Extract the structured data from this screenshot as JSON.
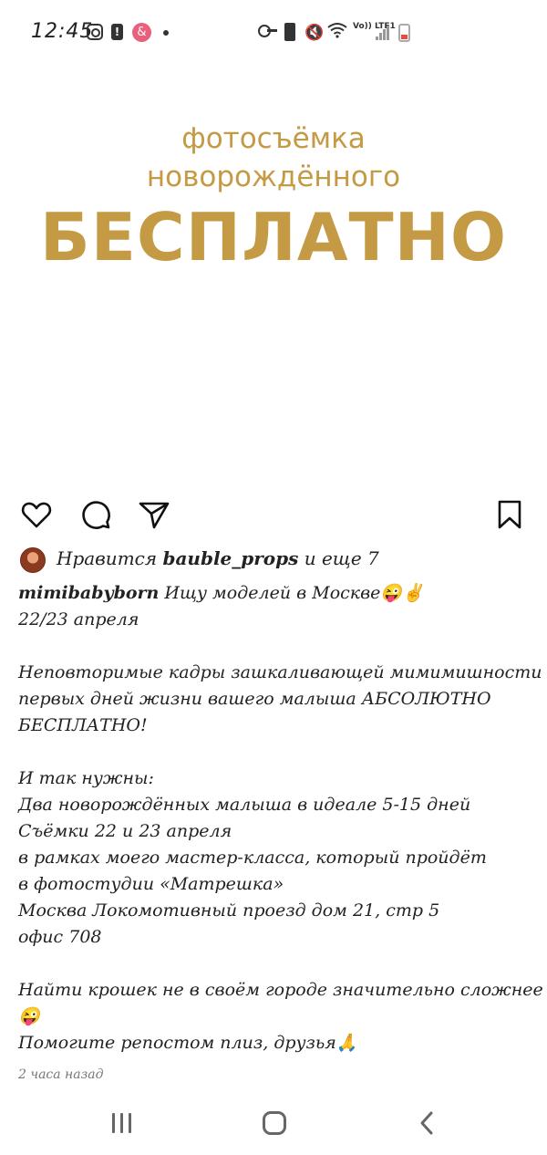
{
  "status_bar": {
    "time": "12:45",
    "volte_text": "Vo)) LTE1"
  },
  "post_image": {
    "line1": "фотосъёмка",
    "line2": "новорождённого",
    "line3": "БЕСПЛАТНО",
    "accent_color": "#c49a45"
  },
  "actions": {
    "icons": [
      "heart-icon",
      "comment-icon",
      "share-icon",
      "bookmark-icon"
    ]
  },
  "likes": {
    "prefix": "Нравится ",
    "user": "bauble_props",
    "suffix": " и еще 7"
  },
  "caption": {
    "username": "mimibabyborn",
    "lines": [
      " Ищу моделей в Москве😜✌",
      "22/23 апреля",
      "",
      "Неповторимые кадры зашкаливающей мимимишности",
      "первых дней жизни вашего малыша АБСОЛЮТНО",
      "БЕСПЛАТНО!",
      "",
      "И так нужны:",
      "Два новорождённых малыша в идеале 5-15 дней",
      "Съёмки 22 и 23 апреля",
      "в рамках моего мастер-класса, который пройдёт",
      "в фотостудии «Матрешка»",
      "Москва Локомотивный проезд дом 21, стр 5",
      "офис 708",
      "",
      "Найти крошек не в своём городе значительно сложнее",
      "😜",
      "Помогите репостом плиз, друзья🙏"
    ]
  },
  "timestamp": "2 часа назад"
}
